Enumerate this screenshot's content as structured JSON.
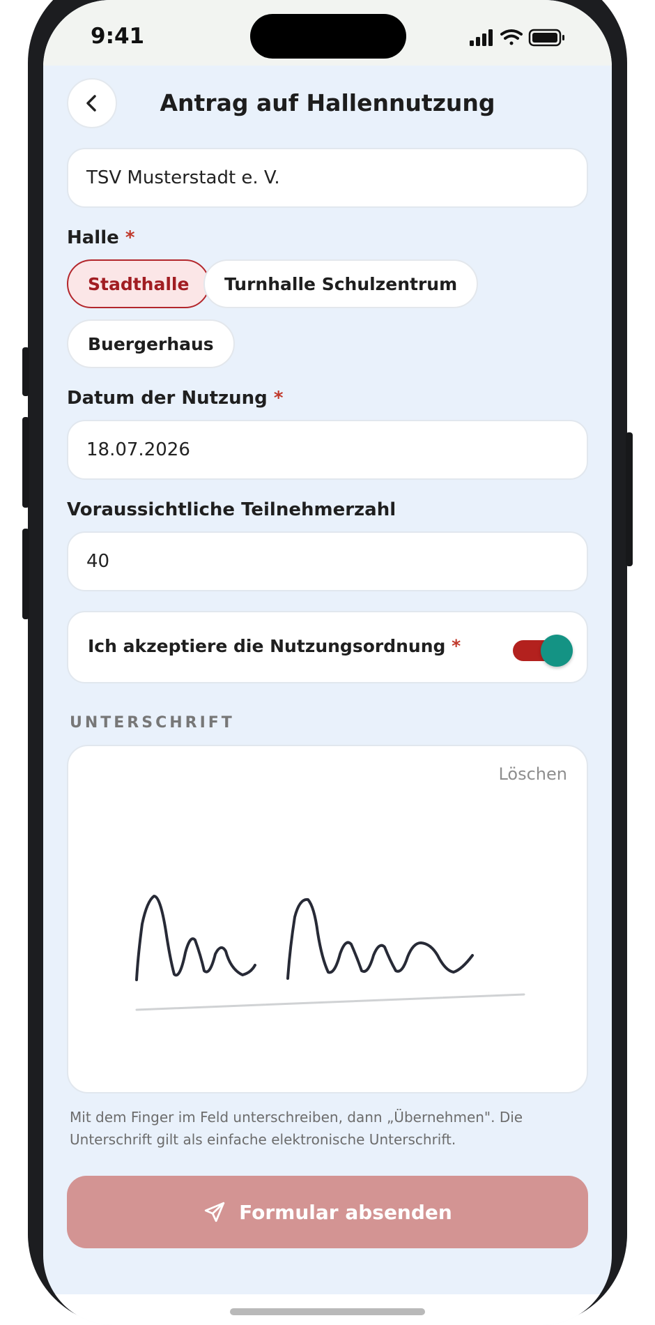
{
  "status": {
    "time": "9:41"
  },
  "header": {
    "title": "Antrag auf Hallennutzung",
    "back_icon": "chevron-left-icon"
  },
  "form": {
    "club_name": {
      "value": "TSV Musterstadt e. V."
    },
    "hall": {
      "label": "Halle",
      "required_mark": "*",
      "options": [
        "Stadthalle",
        "Turnhalle Schulzentrum",
        "Buergerhaus"
      ],
      "selected": "Stadthalle"
    },
    "date": {
      "label": "Datum der Nutzung",
      "required_mark": "*",
      "value": "18.07.2026"
    },
    "participants": {
      "label": "Voraussichtliche Teilnehmerzahl",
      "value": "40"
    },
    "terms": {
      "label": "Ich akzeptiere die Nutzungsordnung",
      "required_mark": "*",
      "checked": true
    },
    "signature": {
      "section_label": "UNTERSCHRIFT",
      "clear_label": "Löschen",
      "helper_line1": "Mit dem Finger im Feld unterschreiben, dann „Übernehmen\". Die",
      "helper_line2": "Unterschrift gilt als einfache elektronische Unterschrift."
    },
    "submit": {
      "label": "Formular absenden",
      "icon": "send-icon"
    }
  },
  "colors": {
    "accent": "#b3262b",
    "toggle_knob": "#149384",
    "submit_disabled": "#d39493",
    "background": "#e9f1fb"
  }
}
